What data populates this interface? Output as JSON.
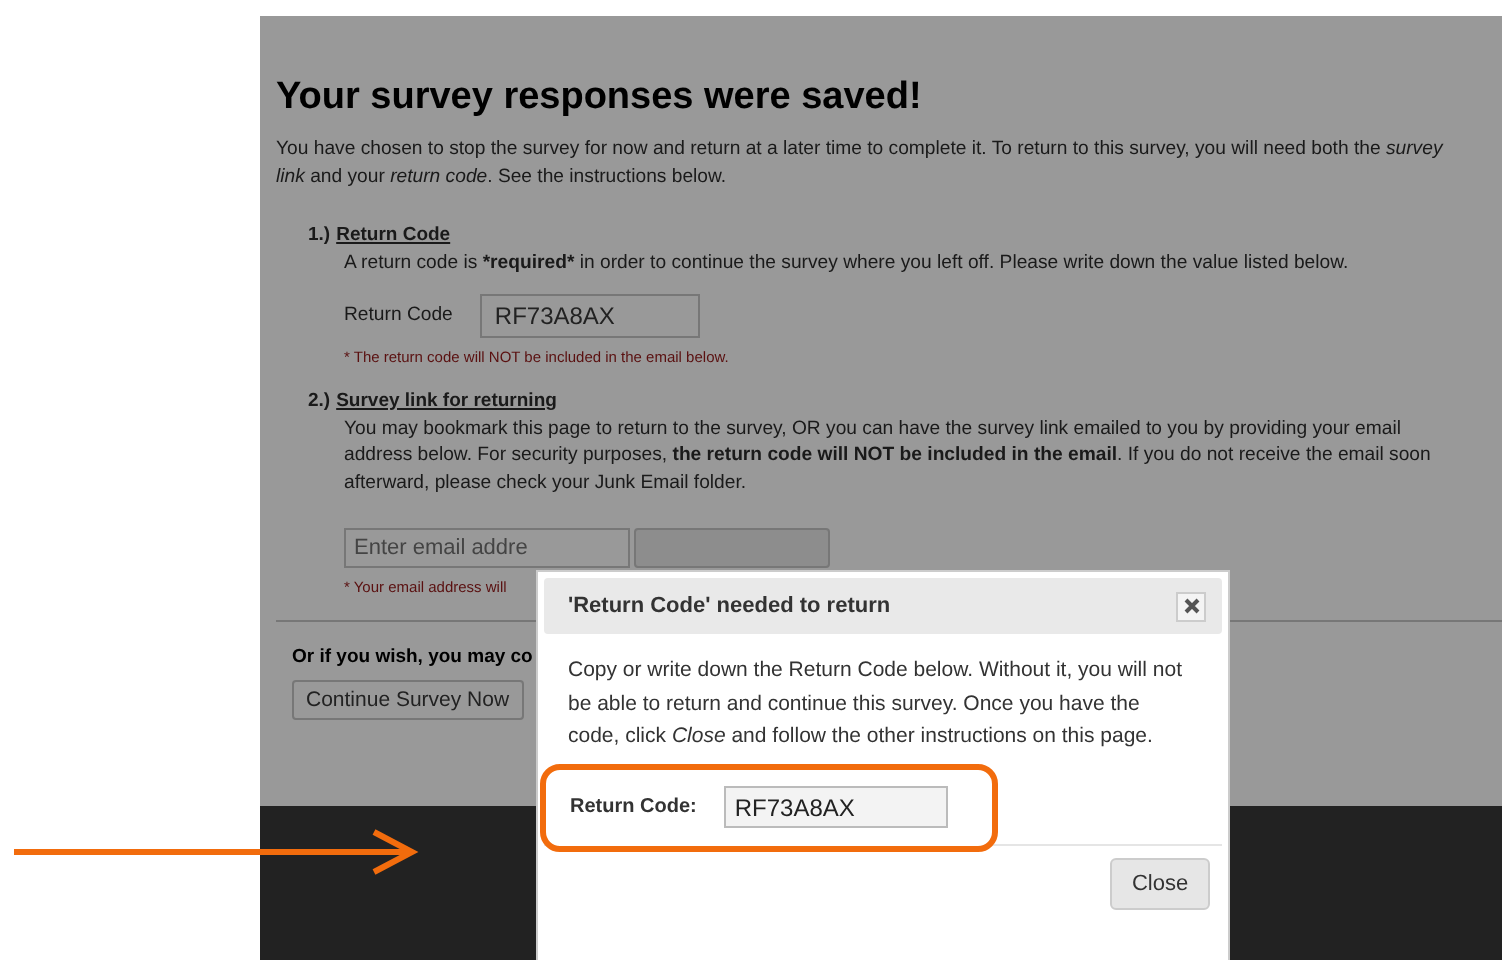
{
  "page": {
    "title": "Your survey responses were saved!",
    "intro_lines": [
      "You have chosen to stop the survey for now and return at a later time to complete it. To return to this survey, you will need both the *survey*",
      "*link* and your *return code*. See the instructions below."
    ],
    "sections": [
      {
        "number": "1.)",
        "heading": "Return Code",
        "text_parts": [
          {
            "text": "A return code is ",
            "bold": false
          },
          {
            "text": "*required*",
            "bold": true
          },
          {
            "text": " in order to continue the survey where you left off. Please write down the value listed below.",
            "bold": false
          }
        ],
        "field_label": "Return Code",
        "field_value": "RF73A8AX",
        "note": "* The return code will NOT be included in the email below."
      },
      {
        "number": "2.)",
        "heading": "Survey link for returning",
        "text_parts": [
          {
            "text": "You may bookmark this page to return to the survey, OR you can have the survey link emailed to you by providing your email address below. For security purposes, ",
            "bold": false
          },
          {
            "text": "the return code will NOT be included in the email",
            "bold": true
          },
          {
            "text": ". If you do not receive the email soon afterward, please check your Junk Email folder.",
            "bold": false
          }
        ],
        "email_placeholder": "Enter email addre",
        "note": "* Your email address will"
      }
    ],
    "continue_text": "Or if you wish, you may co",
    "continue_button": "Continue Survey Now"
  },
  "dialog": {
    "title": "'Return Code' needed to return",
    "body": "Copy or write down the Return Code below. Without it, you will not be able to return and continue this survey. Once you have the code, click *Close* and follow the other instructions on this page.",
    "code_label": "Return Code:",
    "code_value": "RF73A8AX",
    "close_button": "Close"
  }
}
